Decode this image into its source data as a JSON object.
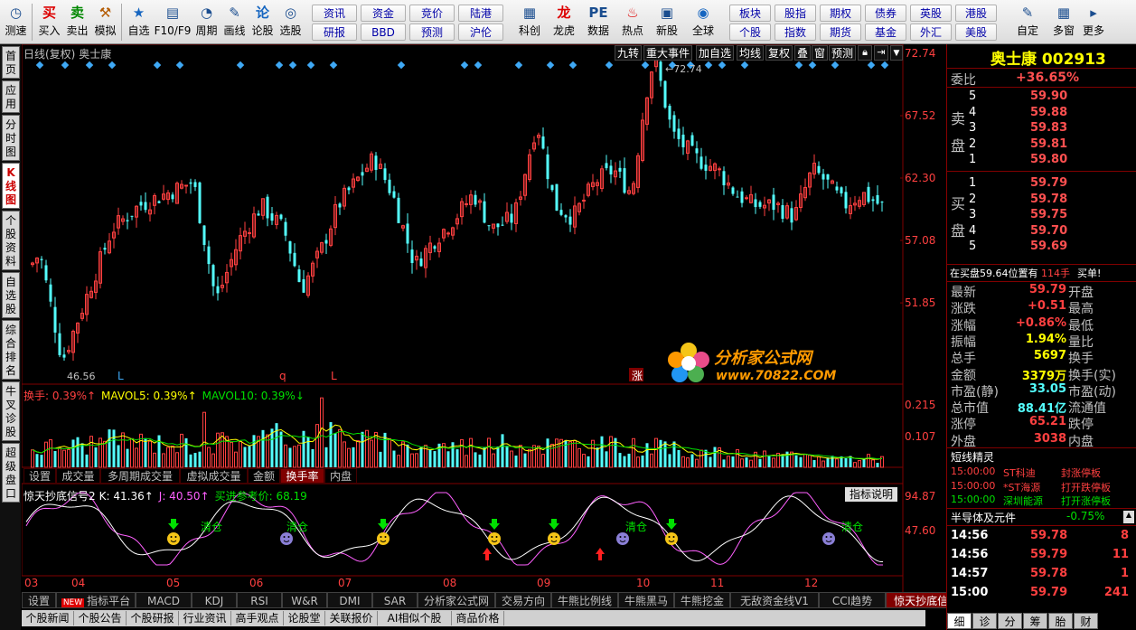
{
  "toolbar": {
    "left_buttons": [
      {
        "icon": "clock-icon",
        "glyph": "◷",
        "label": "测速"
      },
      {
        "icon": "buy-icon",
        "glyph": "买",
        "label": "买入"
      },
      {
        "icon": "sell-icon",
        "glyph": "卖",
        "label": "卖出"
      },
      {
        "icon": "hammer-icon",
        "glyph": "⚒",
        "label": "模拟"
      },
      {
        "icon": "star-icon",
        "glyph": "★",
        "label": "自选"
      },
      {
        "icon": "f10-icon",
        "glyph": "▤",
        "label": "F10/F9"
      },
      {
        "icon": "cycle-icon",
        "glyph": "◔",
        "label": "周期"
      },
      {
        "icon": "pen-icon",
        "glyph": "✎",
        "label": "画线"
      },
      {
        "icon": "discuss-icon",
        "glyph": "论",
        "label": "论股"
      },
      {
        "icon": "select-icon",
        "glyph": "◎",
        "label": "选股"
      }
    ],
    "mid_small_row1": [
      "资讯",
      "资金",
      "竞价",
      "陆港"
    ],
    "mid_small_row2": [
      "研报",
      "BBD",
      "预测",
      "沪伦"
    ],
    "mid_buttons": [
      {
        "icon": "kechuang-icon",
        "glyph": "▦",
        "label": "科创"
      },
      {
        "icon": "dragon-icon",
        "glyph": "龙",
        "label": "龙虎"
      },
      {
        "icon": "data-icon",
        "glyph": "PE",
        "label": "数据"
      },
      {
        "icon": "hot-icon",
        "glyph": "♨",
        "label": "热点"
      },
      {
        "icon": "newstock-icon",
        "glyph": "▣",
        "label": "新股"
      },
      {
        "icon": "globe-icon",
        "glyph": "◉",
        "label": "全球"
      }
    ],
    "right_small_row1": [
      "板块",
      "股指",
      "期权",
      "债券",
      "英股",
      "港股"
    ],
    "right_small_row2": [
      "个股",
      "指数",
      "期货",
      "基金",
      "外汇",
      "美股"
    ],
    "end_buttons": [
      {
        "icon": "custom-icon",
        "glyph": "✎",
        "label": "自定"
      },
      {
        "icon": "multi-window-icon",
        "glyph": "▦",
        "label": "多窗"
      },
      {
        "icon": "more-icon",
        "glyph": "▸",
        "label": "更多"
      }
    ]
  },
  "leftnav": [
    "首页",
    "应用",
    "分时图",
    "K线图",
    "个股资料",
    "自选股",
    "综合排名",
    "牛叉诊股",
    "超级盘口"
  ],
  "leftnav_active": "K线图",
  "chart_header": {
    "period_label": "日线(复权)",
    "stock_name": "奥士康",
    "tools": [
      "九转",
      "重大事件",
      "加自选",
      "均线",
      "复权",
      "叠",
      "窗",
      "预测"
    ]
  },
  "chart_data": [
    {
      "type": "candlestick",
      "title": "日线(复权) 奥士康",
      "yticks": [
        "72.74",
        "67.52",
        "62.30",
        "57.08",
        "51.85"
      ],
      "ylim": [
        46.56,
        72.74
      ],
      "high_label": "72.74",
      "low_label": "46.56",
      "markers": [
        "L",
        "q",
        "L",
        "涨"
      ],
      "xlabels": [
        "03",
        "04",
        "05",
        "06",
        "07",
        "08",
        "09",
        "10",
        "11",
        "12"
      ]
    },
    {
      "type": "bar",
      "title": "换手",
      "legend": [
        {
          "name": "换手",
          "value": "0.39%",
          "arrow": "↑"
        },
        {
          "name": "MAVOL5",
          "value": "0.39%",
          "arrow": "↑"
        },
        {
          "name": "MAVOL10",
          "value": "0.39%",
          "arrow": "↓"
        }
      ],
      "yticks": [
        "0.215",
        "0.107"
      ]
    },
    {
      "type": "line",
      "title": "惊天抄底信号2",
      "legend": [
        {
          "name": "K",
          "value": "41.36",
          "arrow": "↑"
        },
        {
          "name": "J",
          "value": "40.50",
          "arrow": "↑"
        },
        {
          "name": "买进参考价",
          "value": "68.19"
        }
      ],
      "yticks": [
        "94.87",
        "47.60"
      ],
      "annotation": "清仓",
      "explain_button": "指标说明"
    }
  ],
  "volume_tabs": [
    "设置",
    "成交量",
    "多周期成交量",
    "虚拟成交量",
    "金额",
    "换手率",
    "内盘"
  ],
  "volume_tab_active": "换手率",
  "bottom_tabs": [
    "设置",
    "指标平台",
    "MACD",
    "KDJ",
    "RSI",
    "W&R",
    "DMI",
    "SAR",
    "分析家公式网",
    "交易方向",
    "牛熊比例线",
    "牛熊黑马",
    "牛熊挖金",
    "无敌资金线V1",
    "CCI趋势",
    "惊天抄底信号2"
  ],
  "bottom_tab_active": "惊天抄底信号2",
  "new_badge": "NEW",
  "bottom_tabs2": [
    "个股新闻",
    "个股公告",
    "个股研报",
    "行业资讯",
    "高手观点",
    "论股堂",
    "关联报价",
    "AI相似个股",
    "商品价格"
  ],
  "watermark": {
    "title": "分析家公式网",
    "url": "www.70822.COM"
  },
  "quote": {
    "name": "奥士康",
    "code": "002913",
    "webi_label": "委比",
    "webi_value": "+36.65%",
    "sell_label": "卖盘",
    "buy_label": "买盘",
    "sell": [
      {
        "lv": "5",
        "price": "59.90"
      },
      {
        "lv": "4",
        "price": "59.88"
      },
      {
        "lv": "3",
        "price": "59.83"
      },
      {
        "lv": "2",
        "price": "59.81"
      },
      {
        "lv": "1",
        "price": "59.80"
      }
    ],
    "buy": [
      {
        "lv": "1",
        "price": "59.79"
      },
      {
        "lv": "2",
        "price": "59.78"
      },
      {
        "lv": "3",
        "price": "59.75"
      },
      {
        "lv": "4",
        "price": "59.70"
      },
      {
        "lv": "5",
        "price": "59.69"
      }
    ],
    "notice": "在买盘59.64位置有",
    "notice_vol": "114手",
    "notice_tail": "买单!",
    "stats": [
      {
        "l1": "最新",
        "v1": "59.79",
        "l2": "开盘",
        "v2": ""
      },
      {
        "l1": "涨跌",
        "v1": "+0.51",
        "l2": "最高",
        "v2": ""
      },
      {
        "l1": "涨幅",
        "v1": "+0.86%",
        "l2": "最低",
        "v2": ""
      },
      {
        "l1": "振幅",
        "v1": "1.94%",
        "l2": "量比",
        "v2": ""
      },
      {
        "l1": "总手",
        "v1": "5697",
        "l2": "换手",
        "v2": ""
      },
      {
        "l1": "金额",
        "v1": "3379万",
        "l2": "换手(实)",
        "v2": ""
      },
      {
        "l1": "市盈(静)",
        "v1": "33.05",
        "l2": "市盈(动)",
        "v2": ""
      },
      {
        "l1": "总市值",
        "v1": "88.41亿",
        "l2": "流通值",
        "v2": ""
      },
      {
        "l1": "涨停",
        "v1": "65.21",
        "l2": "跌停",
        "v2": ""
      },
      {
        "l1": "外盘",
        "v1": "3038",
        "l2": "内盘",
        "v2": ""
      }
    ],
    "sprite_title": "短线精灵",
    "sprite": [
      {
        "time": "15:00:00",
        "name": "ST科迪",
        "event": "封涨停板"
      },
      {
        "time": "15:00:00",
        "name": "*ST海源",
        "event": "打开跌停板"
      },
      {
        "time": "15:00:00",
        "name": "深圳能源",
        "event": "打开涨停板"
      }
    ],
    "sector_name": "半导体及元件",
    "sector_change": "-0.75%",
    "ticks": [
      {
        "time": "14:56",
        "price": "59.78",
        "vol": "8"
      },
      {
        "time": "14:56",
        "price": "59.79",
        "vol": "11"
      },
      {
        "time": "14:57",
        "price": "59.78",
        "vol": "1"
      },
      {
        "time": "15:00",
        "price": "59.79",
        "vol": "241"
      }
    ],
    "bottom_tabs": [
      "细",
      "诊",
      "分",
      "筹",
      "胎",
      "财"
    ]
  }
}
